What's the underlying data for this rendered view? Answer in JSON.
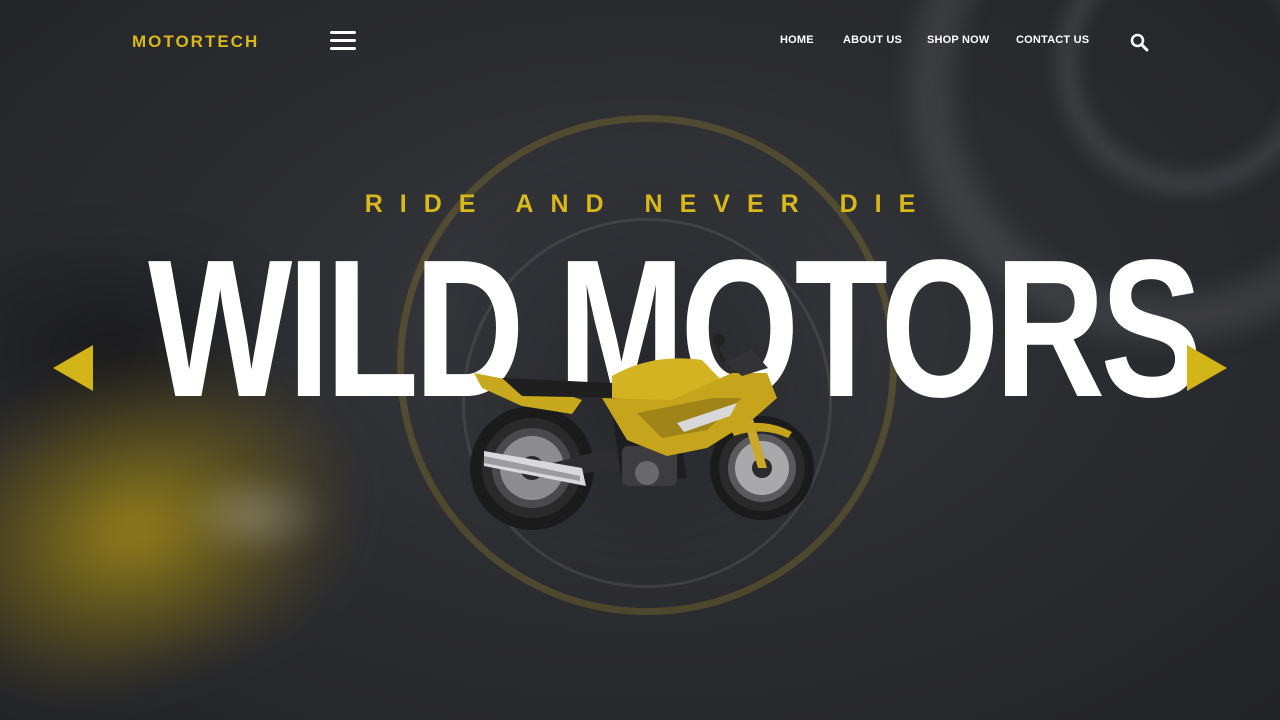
{
  "brand": {
    "name": "MOTORTECH"
  },
  "nav": {
    "items": [
      {
        "label": "HOME"
      },
      {
        "label": "ABOUT US"
      },
      {
        "label": "SHOP NOW"
      },
      {
        "label": "CONTACT US"
      }
    ]
  },
  "icons": {
    "menu": "hamburger-menu-icon",
    "search": "search-icon",
    "prev": "triangle-left-arrow-icon",
    "next": "triangle-right-arrow-icon"
  },
  "hero": {
    "tagline": "RIDE AND NEVER DIE",
    "headline": "WILD MOTORS"
  },
  "colors": {
    "accent": "#d8b81b",
    "background": "#2c2d31",
    "text": "#ffffff"
  }
}
